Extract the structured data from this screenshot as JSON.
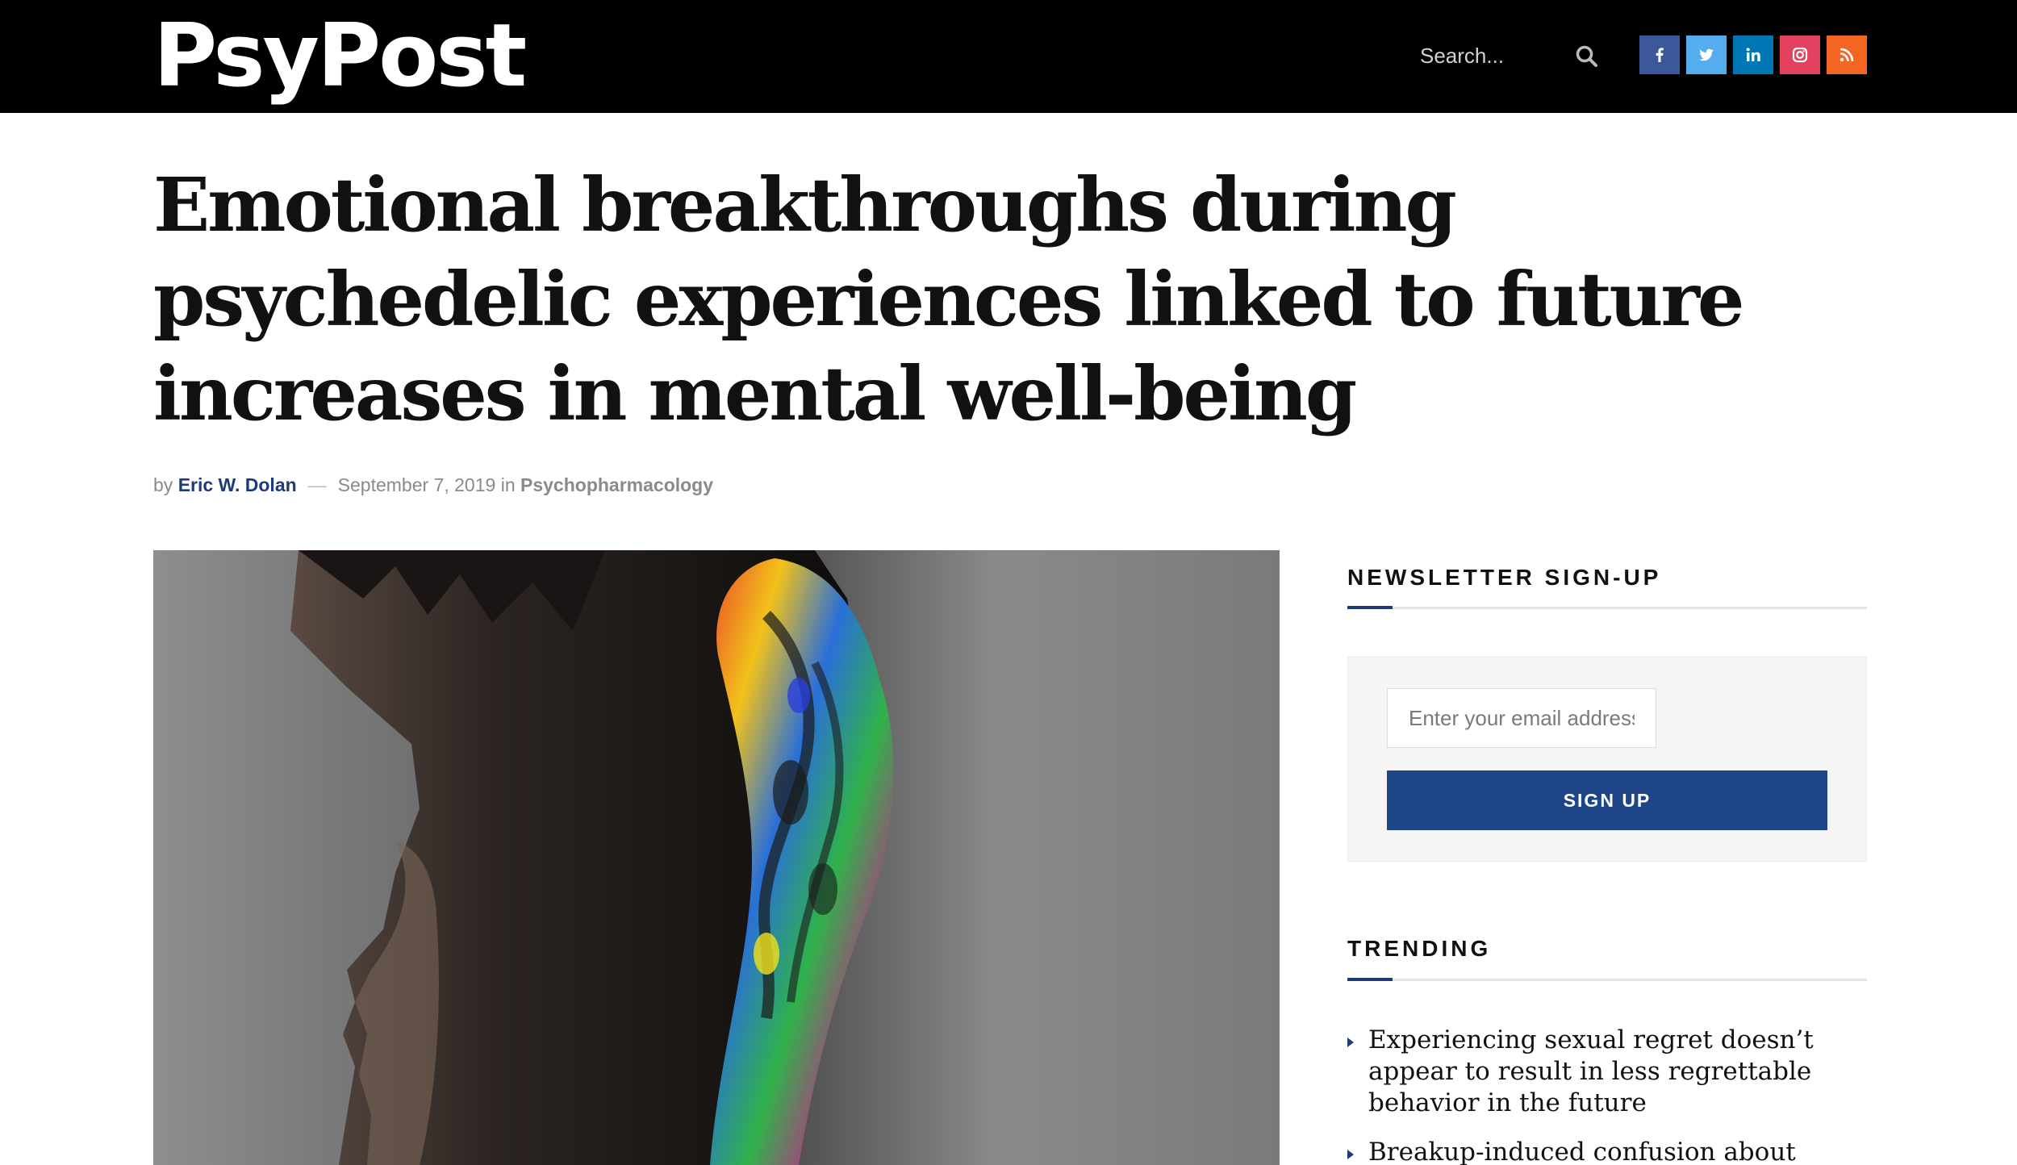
{
  "header": {
    "logo_text": "PsyPost",
    "search_placeholder": "Search...",
    "social": [
      {
        "name": "facebook",
        "icon": "facebook-icon",
        "color": "#3b5998"
      },
      {
        "name": "twitter",
        "icon": "twitter-icon",
        "color": "#55acee"
      },
      {
        "name": "linkedin",
        "icon": "linkedin-icon",
        "color": "#0077b5"
      },
      {
        "name": "instagram",
        "icon": "instagram-icon",
        "color": "#e4405f"
      },
      {
        "name": "rss",
        "icon": "rss-icon",
        "color": "#f26522"
      }
    ]
  },
  "article": {
    "title": "Emotional breakthroughs during psychedelic experiences linked to future increases in mental well-being",
    "by_label": "by",
    "author": "Eric W. Dolan",
    "separator": "—",
    "date": "September 7, 2019",
    "in_label": "in",
    "category": "Psychopharmacology",
    "hero_image": "man-profile-psychedelic-art"
  },
  "sidebar": {
    "newsletter": {
      "heading": "NEWSLETTER SIGN-UP",
      "email_placeholder": "Enter your email address",
      "button_label": "SIGN UP"
    },
    "trending": {
      "heading": "TRENDING",
      "items": [
        "Experiencing sexual regret doesn’t appear to result in less regrettable behavior in the future",
        "Breakup-induced confusion about one’s"
      ]
    }
  },
  "colors": {
    "header_bg": "#000000",
    "accent": "#1e3b78",
    "button": "#1d4587"
  }
}
